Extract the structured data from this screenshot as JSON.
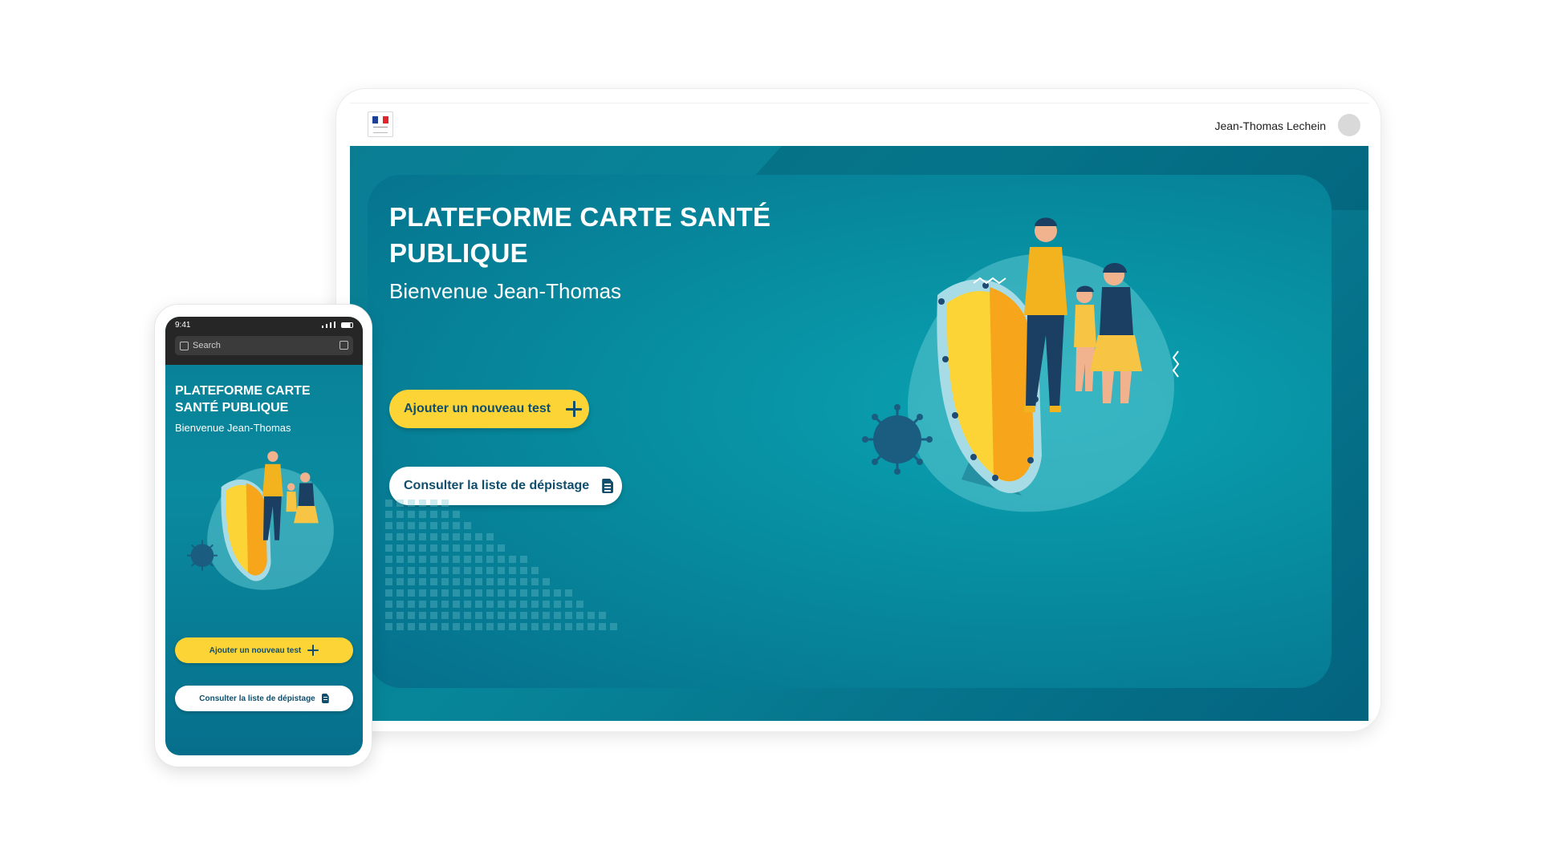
{
  "colors": {
    "primary_teal": "#078699",
    "deep_teal": "#04637f",
    "accent_yellow": "#fdd435",
    "button_text": "#0f4e6c",
    "white": "#ffffff"
  },
  "tablet": {
    "header": {
      "logo_icon": "republique-francaise-logo-icon",
      "user_name": "Jean-Thomas Lechein",
      "avatar_icon": "user-avatar-icon"
    },
    "hero": {
      "title": "PLATEFORME CARTE SANTÉ PUBLIQUE",
      "welcome": "Bienvenue Jean-Thomas"
    },
    "buttons": {
      "add_test": "Ajouter un nouveau test",
      "list_screening": "Consulter la liste de dépistage"
    },
    "icons": {
      "add": "plus-icon",
      "list": "document-icon",
      "illustration": "family-shield-virus-illustration"
    }
  },
  "phone": {
    "status_bar": {
      "time": "9:41"
    },
    "search": {
      "placeholder": "Search"
    },
    "hero": {
      "title": "PLATEFORME CARTE SANTÉ PUBLIQUE",
      "welcome": "Bienvenue Jean-Thomas"
    },
    "buttons": {
      "add_test": "Ajouter un nouveau test",
      "list_screening": "Consulter la liste de dépistage"
    }
  }
}
